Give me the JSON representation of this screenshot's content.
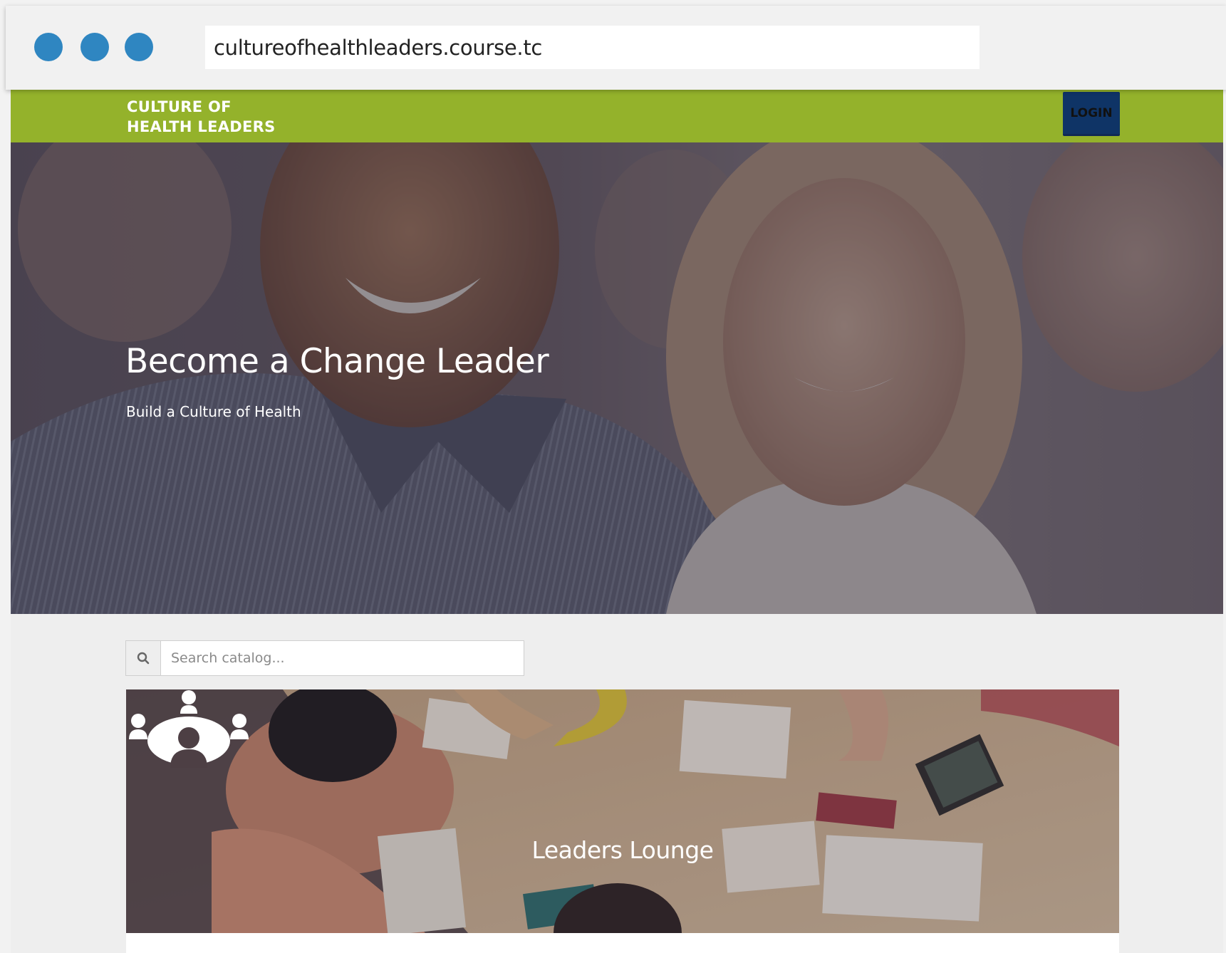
{
  "browser": {
    "url": "cultureofhealthleaders.course.tc",
    "dot_color": "#2f86c1"
  },
  "header": {
    "logo_line1": "CULTURE OF",
    "logo_line2": "HEALTH LEADERS",
    "login_label": "LOGIN",
    "brand_color": "#94b22b",
    "login_color": "#0f3466"
  },
  "hero": {
    "title": "Become a Change Leader",
    "subtitle": "Build a Culture of Health"
  },
  "search": {
    "placeholder": "Search catalog...",
    "value": "",
    "icon": "search-icon"
  },
  "catalog": {
    "cards": [
      {
        "title": "Leaders Lounge",
        "icon": "people-group-icon"
      }
    ]
  }
}
